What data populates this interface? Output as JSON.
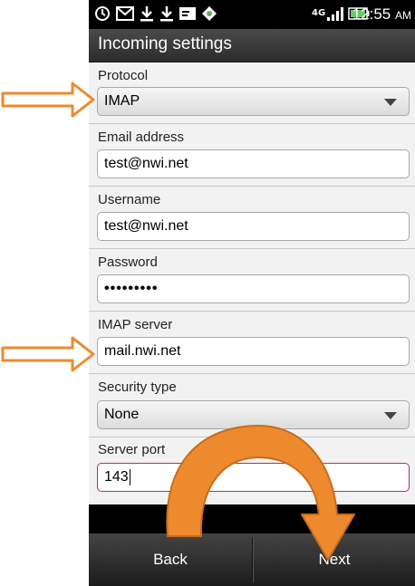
{
  "status_bar": {
    "time": "12:55",
    "ampm": "AM",
    "network": "4G",
    "icons": [
      "alarm-icon",
      "gmail-icon",
      "download-icon",
      "download-icon",
      "email-icon",
      "app-icon",
      "network-4g-icon",
      "signal-icon",
      "battery-icon"
    ]
  },
  "header": {
    "title": "Incoming settings"
  },
  "form": {
    "protocol": {
      "label": "Protocol",
      "value": "IMAP"
    },
    "email": {
      "label": "Email address",
      "value": "test@nwi.net"
    },
    "username": {
      "label": "Username",
      "value": "test@nwi.net"
    },
    "password": {
      "label": "Password",
      "value": "•••••••••"
    },
    "server": {
      "label": "IMAP server",
      "value": "mail.nwi.net"
    },
    "security": {
      "label": "Security type",
      "value": "None"
    },
    "port": {
      "label": "Server port",
      "value": "143"
    }
  },
  "bottom_bar": {
    "back_label": "Back",
    "next_label": "Next"
  },
  "colors": {
    "annotation_arrow": "#ee8a2e",
    "focus_border": "#b8314d"
  }
}
